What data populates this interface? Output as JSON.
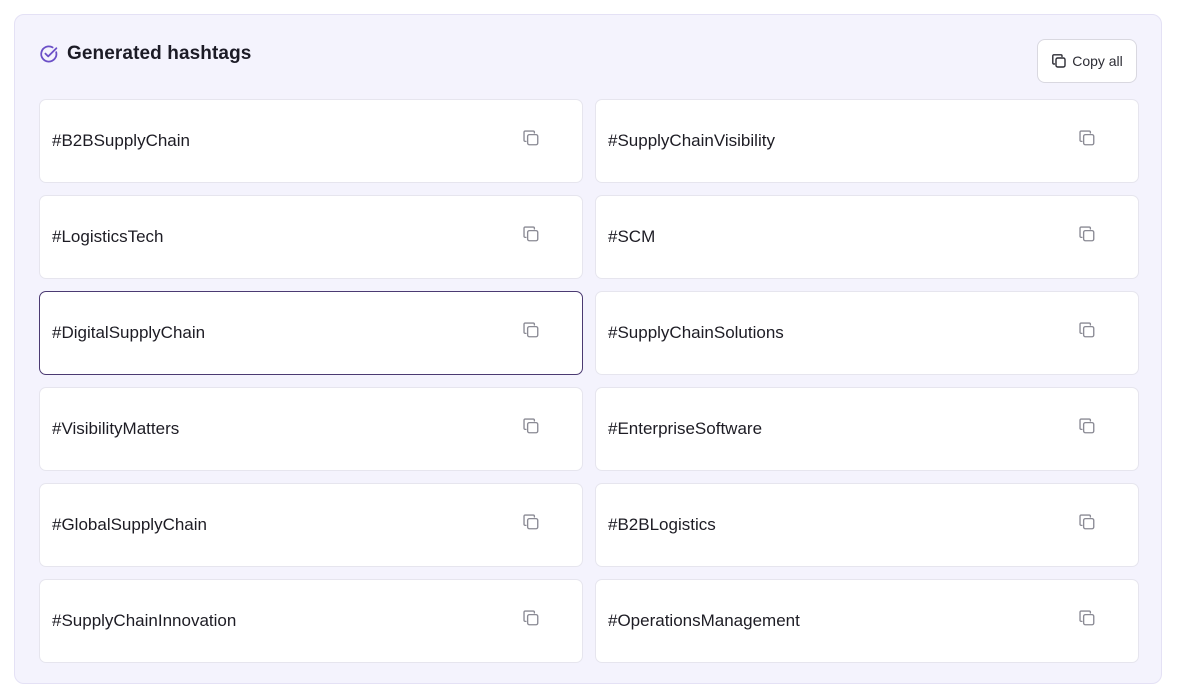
{
  "header": {
    "title": "Generated hashtags",
    "check_icon": "circle-check-icon",
    "accent_color": "#6b4fc7"
  },
  "toolbar": {
    "copy_all_label": "Copy all",
    "copy_icon": "copy-icon"
  },
  "hashtags": [
    {
      "text": "#B2BSupplyChain",
      "selected": false
    },
    {
      "text": "#SupplyChainVisibility",
      "selected": false
    },
    {
      "text": "#LogisticsTech",
      "selected": false
    },
    {
      "text": "#SCM",
      "selected": false
    },
    {
      "text": "#DigitalSupplyChain",
      "selected": true
    },
    {
      "text": "#SupplyChainSolutions",
      "selected": false
    },
    {
      "text": "#VisibilityMatters",
      "selected": false
    },
    {
      "text": "#EnterpriseSoftware",
      "selected": false
    },
    {
      "text": "#GlobalSupplyChain",
      "selected": false
    },
    {
      "text": "#B2BLogistics",
      "selected": false
    },
    {
      "text": "#SupplyChainInnovation",
      "selected": false
    },
    {
      "text": "#OperationsManagement",
      "selected": false
    }
  ],
  "colors": {
    "panel_bg": "#f4f3fd",
    "card_border": "#e6e5ee",
    "selected_border": "#4b3a72",
    "icon_gray": "#8a8a94"
  }
}
